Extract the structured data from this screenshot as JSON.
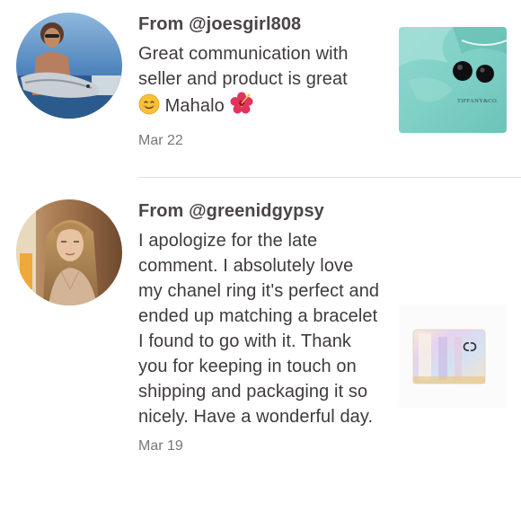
{
  "reviews": [
    {
      "from_prefix": "From ",
      "handle": "@joesgirl808",
      "text_line1": "Great communication with seller and product is great",
      "text_after_emoji": "Mahalo",
      "emoji_1": "smiling-face-emoji",
      "emoji_2": "hibiscus-emoji",
      "date": "Mar 22",
      "product_label": "TIFFANY&CO."
    },
    {
      "from_prefix": "From ",
      "handle": "@greenidgypsy",
      "text": "I apologize for the late comment. I absolutely love my chanel ring it's perfect and ended up matching a bracelet I found to go with it. Thank you for keeping in touch on shipping and packaging it so nicely. Have a wonderful day.",
      "date": "Mar 19"
    }
  ]
}
